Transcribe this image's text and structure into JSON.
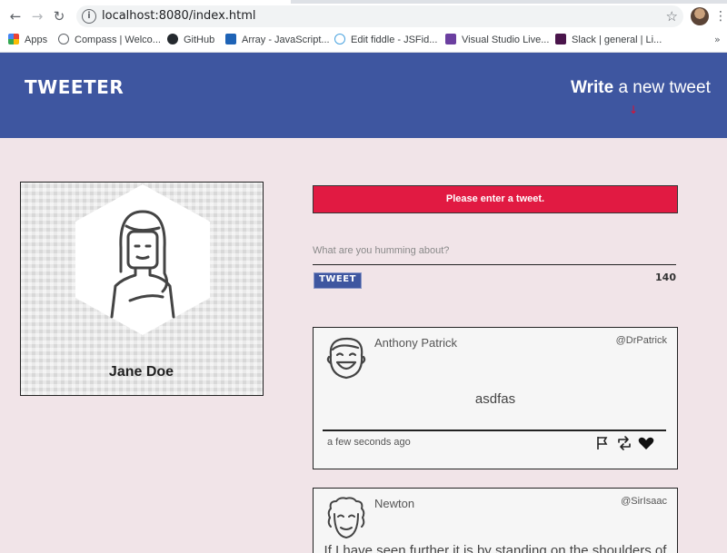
{
  "browser": {
    "url": "localhost:8080/index.html",
    "bookmarks": [
      {
        "label": "Apps",
        "color": "#e94235"
      },
      {
        "label": "Compass | Welco...",
        "color": "#5f6368"
      },
      {
        "label": "GitHub",
        "color": "#24292e"
      },
      {
        "label": "Array - JavaScript...",
        "color": "#1e63b6"
      },
      {
        "label": "Edit fiddle - JSFid...",
        "color": "#4aa3df"
      },
      {
        "label": "Visual Studio Live...",
        "color": "#6b3fa0"
      },
      {
        "label": "Slack | general | Li...",
        "color": "#4a154b"
      }
    ]
  },
  "header": {
    "logo": "TWEETER",
    "write_bold": "Write",
    "write_rest": " a new tweet",
    "arrow": "↓"
  },
  "profile": {
    "name": "Jane Doe"
  },
  "compose": {
    "error": "Please enter a tweet.",
    "placeholder": "What are you humming about?",
    "button": "TWEET",
    "counter": "140"
  },
  "tweets": [
    {
      "name": "Anthony Patrick",
      "handle": "@DrPatrick",
      "body": "asdfas",
      "time": "a few seconds ago"
    },
    {
      "name": "Newton",
      "handle": "@SirIsaac",
      "body": "If I have seen further it is by standing on the shoulders of",
      "time": ""
    }
  ],
  "colors": {
    "header": "#3e56a0",
    "error": "#e11a42",
    "page": "#f1e4e8"
  }
}
